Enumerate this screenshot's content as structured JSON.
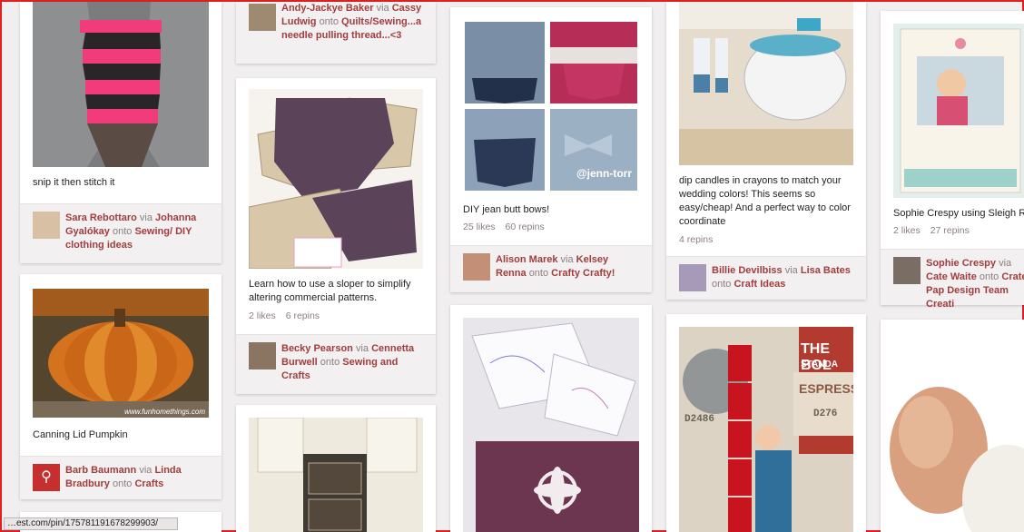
{
  "pins": {
    "p1": {
      "desc": "snip it then stitch it",
      "user": "Sara Rebottaro",
      "via": "via",
      "via_user": "Johanna Gyalókay",
      "onto": "onto",
      "board": "Sewing/ DIY clothing ideas"
    },
    "p2": {
      "desc": "Canning Lid Pumpkin",
      "user": "Barb Baumann",
      "via": "via",
      "via_user": "Linda Bradbury",
      "onto": "onto",
      "board": "Crafts"
    },
    "p3": {
      "user": "Andy-Jackye Baker",
      "via": "via",
      "via_user": "Cassy Ludwig",
      "onto": "onto",
      "board": "Quilts/Sewing...a needle pulling thread...<3"
    },
    "p4": {
      "desc": "Learn how to use a sloper to simplify altering commercial patterns.",
      "likes": "2 likes",
      "repins": "6 repins",
      "user": "Becky Pearson",
      "via": "via",
      "via_user": "Cennetta Burwell",
      "onto": "onto",
      "board": "Sewing and Crafts"
    },
    "p5": {
      "desc": "DIY jean butt bows!",
      "likes": "25 likes",
      "repins": "60 repins",
      "user": "Alison Marek",
      "via": "via",
      "via_user": "Kelsey Renna",
      "onto": "onto",
      "board": "Crafty Crafty!",
      "watermark": "@jenn-torr"
    },
    "p6": {
      "desc": "dip candles in crayons to match your wedding colors! This seems so easy/cheap! And a perfect way to color coordinate",
      "repins": "4 repins",
      "user": "Billie Devilbiss",
      "via": "via",
      "via_user": "Lisa Bates",
      "onto": "onto",
      "board": "Craft Ideas"
    },
    "p7": {
      "desc": "Sophie Crespy using Sleigh R",
      "likes": "2 likes",
      "repins": "27 repins",
      "user": "Sophie Crespy",
      "via": "via",
      "via_user": "Cate Waite",
      "onto": "onto",
      "board": "Crate Pap Design Team Creati"
    },
    "p8": {
      "sign_top": "THE BOL",
      "sign_mid": "STANDA",
      "sign_bottom": "ESPRESS",
      "code1": "D2486",
      "code2": "D276"
    }
  },
  "pumpkin_caption": "www.funhomethings.com",
  "status_url": "…est.com/pin/175781191678299903/",
  "colors": {
    "accent": "#a23d3d",
    "border": "#e02020"
  }
}
